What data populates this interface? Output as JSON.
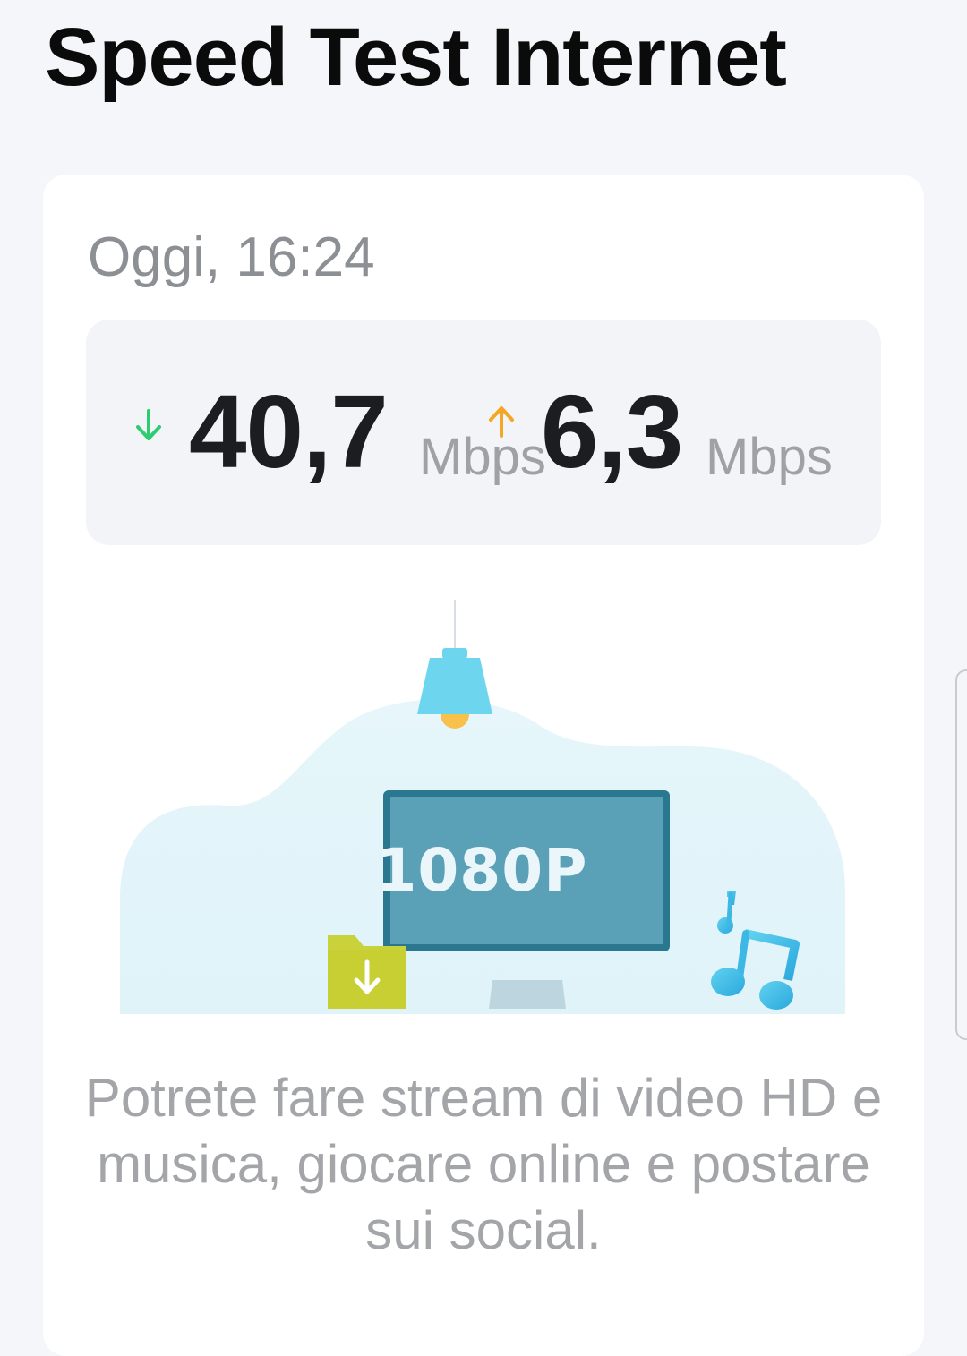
{
  "header": {
    "title": "Speed Test Internet"
  },
  "result": {
    "timestamp": "Oggi, 16:24",
    "download": {
      "value": "40,7",
      "unit": "Mbps",
      "icon": "arrow-down-icon",
      "color": "#2ecc71"
    },
    "upload": {
      "value": "6,3",
      "unit": "Mbps",
      "icon": "arrow-up-icon",
      "color": "#f5a623"
    },
    "illustration": {
      "screen_label": "1080P",
      "icons": [
        "lamp-icon",
        "monitor-icon",
        "download-folder-icon",
        "music-notes-icon"
      ]
    },
    "description": "Potrete fare stream di video HD e musica, giocare online e postare sui social."
  }
}
